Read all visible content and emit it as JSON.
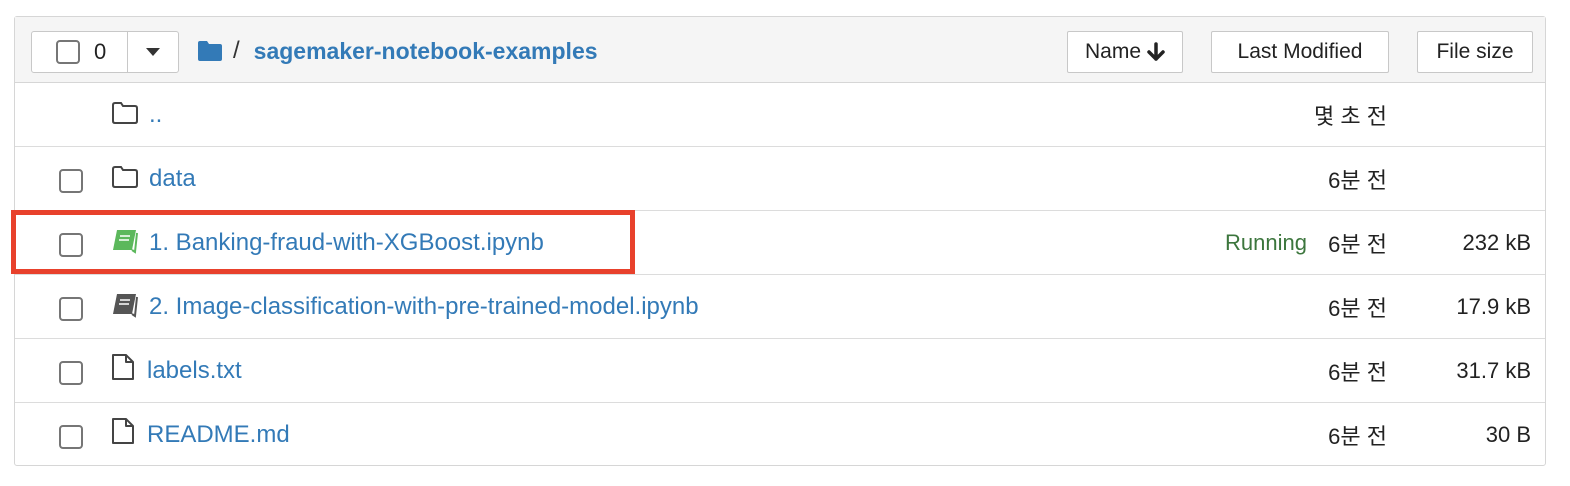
{
  "header": {
    "selected_count": "0",
    "breadcrumb_sep": "/",
    "folder_name": "sagemaker-notebook-examples",
    "sort_buttons": [
      "Name",
      "Last Modified",
      "File size"
    ]
  },
  "files": [
    {
      "name": "..",
      "type": "parent-folder",
      "modified": "몇 초 전",
      "status": "",
      "size": ""
    },
    {
      "name": "data",
      "type": "folder",
      "modified": "6분 전",
      "status": "",
      "size": ""
    },
    {
      "name": "1. Banking-fraud-with-XGBoost.ipynb",
      "type": "notebook-running",
      "modified": "6분 전",
      "status": "Running",
      "size": "232 kB"
    },
    {
      "name": "2. Image-classification-with-pre-trained-model.ipynb",
      "type": "notebook",
      "modified": "6분 전",
      "status": "",
      "size": "17.9 kB"
    },
    {
      "name": "labels.txt",
      "type": "file",
      "modified": "6분 전",
      "status": "",
      "size": "31.7 kB"
    },
    {
      "name": "README.md",
      "type": "file",
      "modified": "6분 전",
      "status": "",
      "size": "30 B"
    }
  ],
  "colors": {
    "link": "#337ab7",
    "running": "#3c763d",
    "highlight": "#e8412c",
    "notebook_running_icon": "#5cb85c"
  }
}
